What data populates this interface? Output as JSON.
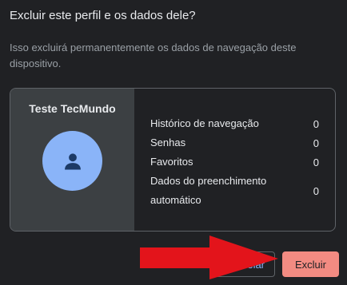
{
  "dialog": {
    "title": "Excluir este perfil e os dados dele?",
    "description": "Isso excluirá permanentemente os dados de navegação deste dispositivo."
  },
  "profile": {
    "name": "Teste TecMundo",
    "avatar_icon": "person-icon",
    "avatar_color": "#8ab4f8"
  },
  "data_items": [
    {
      "label": "Histórico de navegação",
      "count": "0"
    },
    {
      "label": "Senhas",
      "count": "0"
    },
    {
      "label": "Favoritos",
      "count": "0"
    },
    {
      "label": "Dados do preenchimento automático",
      "count": "0"
    }
  ],
  "buttons": {
    "cancel_label": "Cancelar",
    "delete_label": "Excluir"
  },
  "colors": {
    "background": "#202124",
    "accent": "#8ab4f8",
    "danger": "#f28b82",
    "annotation_arrow": "#e3141b"
  }
}
